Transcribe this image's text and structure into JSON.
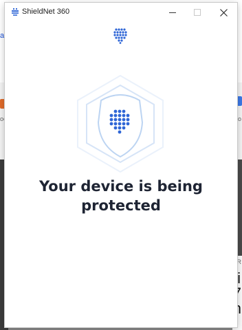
{
  "window": {
    "title": "ShieldNet 360",
    "controls": [
      "minimize",
      "maximize",
      "close"
    ]
  },
  "main": {
    "headline": "Your device is being protected",
    "logo_icon": "shieldnet-heart-dots-icon",
    "hero_icon": "shield-hexagon-icon"
  },
  "background_fragments": {
    "left_link": "ac",
    "left_label": "oe",
    "right_label": "lo",
    "right_small": "e R",
    "right_big_1": "i",
    "right_big_2": "7",
    "right_big_3": "h"
  },
  "colors": {
    "brand_blue": "#2f66d6",
    "headline": "#1e2433",
    "shield_outline": "#bcd4f2"
  }
}
